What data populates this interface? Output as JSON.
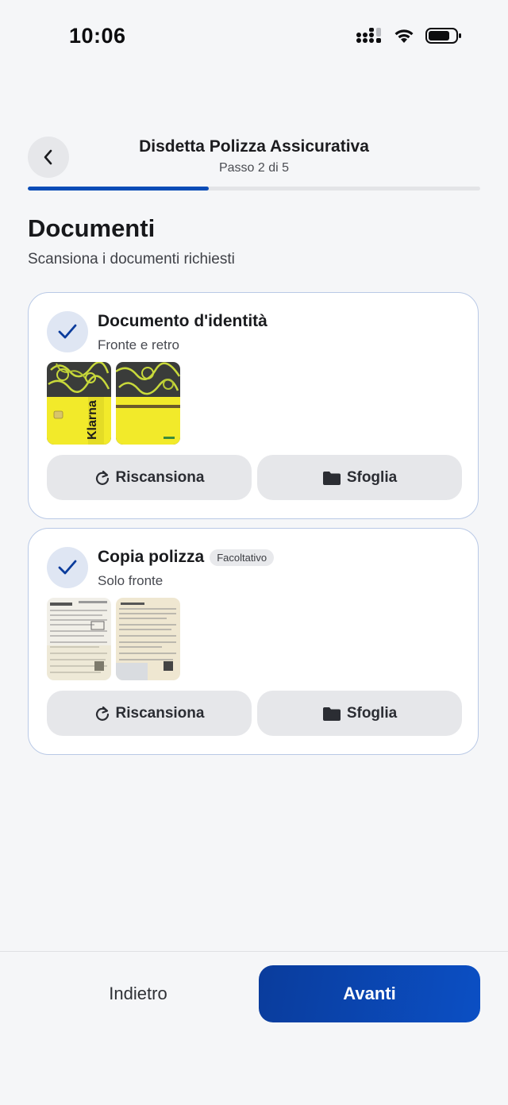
{
  "status_bar": {
    "time": "10:06"
  },
  "header": {
    "title": "Disdetta Polizza Assicurativa",
    "step": "Passo 2 di 5",
    "progress_fraction": 0.4
  },
  "page": {
    "title": "Documenti",
    "subtitle": "Scansiona i documenti richiesti"
  },
  "cards": [
    {
      "title": "Documento d'identità",
      "subtitle": "Fronte e retro",
      "completed": true,
      "rescan_label": "Riscansiona",
      "browse_label": "Sfoglia",
      "thumbnails": [
        "Klarna"
      ]
    },
    {
      "title": "Copia polizza",
      "badge": "Facoltativo",
      "subtitle": "Solo fronte",
      "completed": true,
      "rescan_label": "Riscansiona",
      "browse_label": "Sfoglia"
    }
  ],
  "footer": {
    "back_label": "Indietro",
    "next_label": "Avanti"
  },
  "colors": {
    "accent": "#0a4cb7",
    "card_border": "#b9c9e6",
    "check_bg": "#dfe6f3"
  },
  "icons": [
    "back-chevron-icon",
    "check-icon",
    "refresh-icon",
    "folder-icon",
    "signal-icon",
    "wifi-icon",
    "battery-icon"
  ]
}
